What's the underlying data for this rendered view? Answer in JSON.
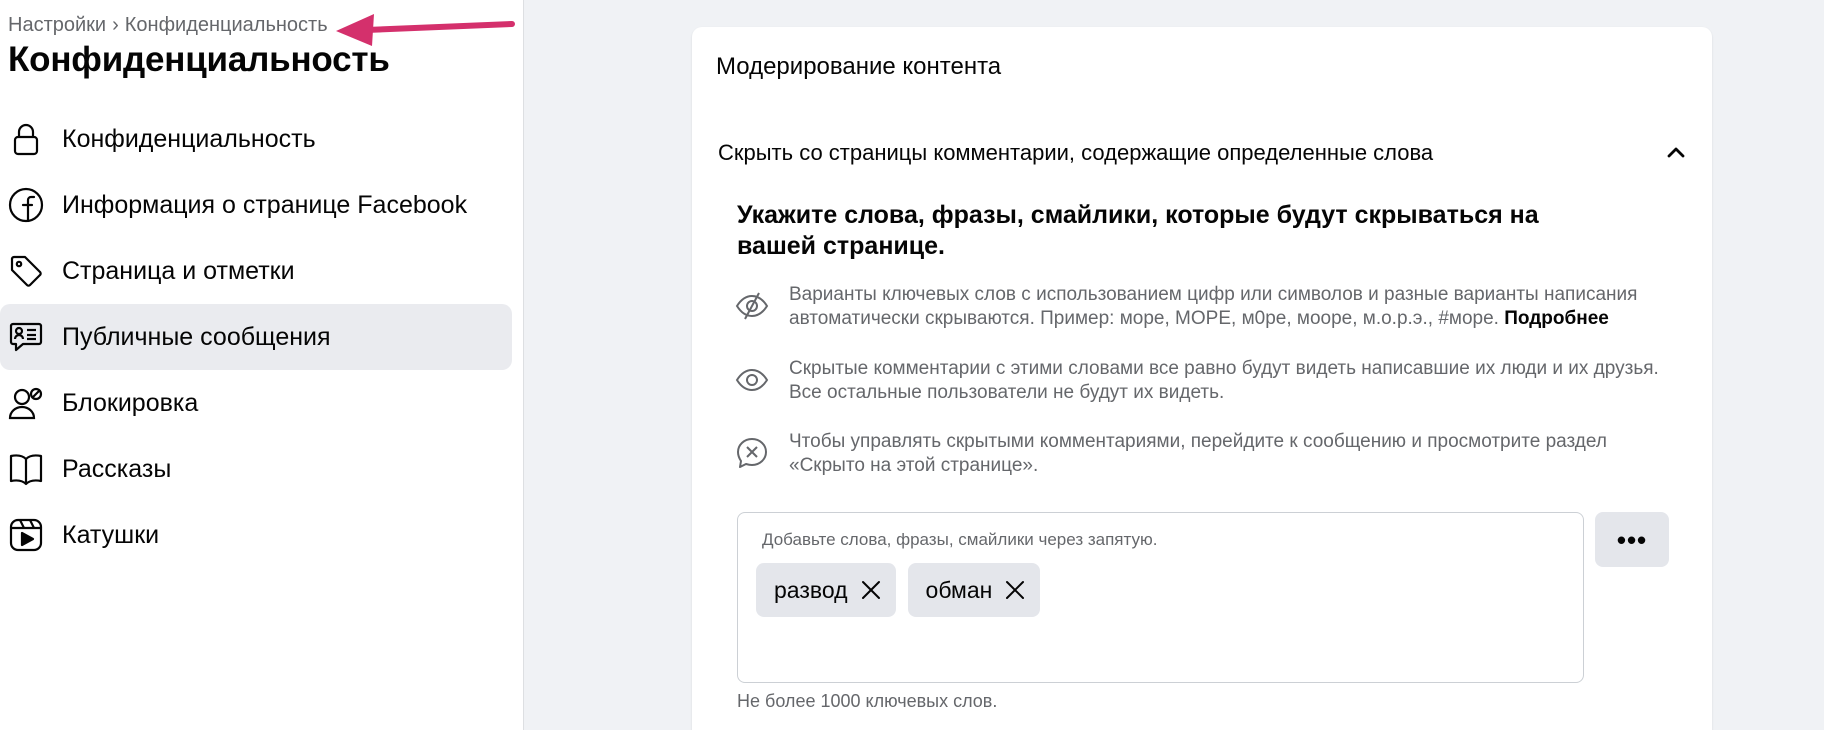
{
  "breadcrumb": {
    "root": "Настройки",
    "separator": "›",
    "current": "Конфиденциальность"
  },
  "annotation": {
    "arrow_color": "#d4306c"
  },
  "page_title": "Конфиденциальность",
  "nav": {
    "items": [
      {
        "label": "Конфиденциальность",
        "icon": "lock-icon"
      },
      {
        "label": "Информация о странице Facebook",
        "icon": "facebook-icon"
      },
      {
        "label": "Страница и отметки",
        "icon": "tag-icon"
      },
      {
        "label": "Публичные сообщения",
        "icon": "public-posts-icon",
        "active": true
      },
      {
        "label": "Блокировка",
        "icon": "block-user-icon"
      },
      {
        "label": "Рассказы",
        "icon": "book-icon"
      },
      {
        "label": "Катушки",
        "icon": "reels-icon"
      }
    ]
  },
  "card": {
    "title": "Модерирование контента",
    "section": {
      "header": "Скрыть со страницы комментарии, содержащие определенные слова",
      "expanded": true,
      "lead": "Укажите слова, фразы, смайлики, которые будут скрываться на вашей странице.",
      "info": [
        {
          "icon": "eye-slash-icon",
          "text": "Варианты ключевых слов с использованием цифр или символов и разные варианты написания автоматически скрываются. Пример: море, МОРЕ, м0ре, мооре, м.о.р.э., #море.",
          "link": "Подробнее"
        },
        {
          "icon": "eye-icon",
          "text": "Скрытые комментарии с этими словами все равно будут видеть написавшие их люди и их друзья. Все остальные пользователи не будут их видеть."
        },
        {
          "icon": "comment-x-icon",
          "text": "Чтобы управлять скрытыми комментариями, перейдите к сообщению и просмотрите раздел «Скрыто на этой странице»."
        }
      ],
      "words_input": {
        "placeholder": "Добавьте слова, фразы, смайлики через запятую.",
        "chips": [
          "развод",
          "обман"
        ]
      },
      "more_button": "•••",
      "limit_note": "Не более 1000 ключевых слов."
    }
  }
}
